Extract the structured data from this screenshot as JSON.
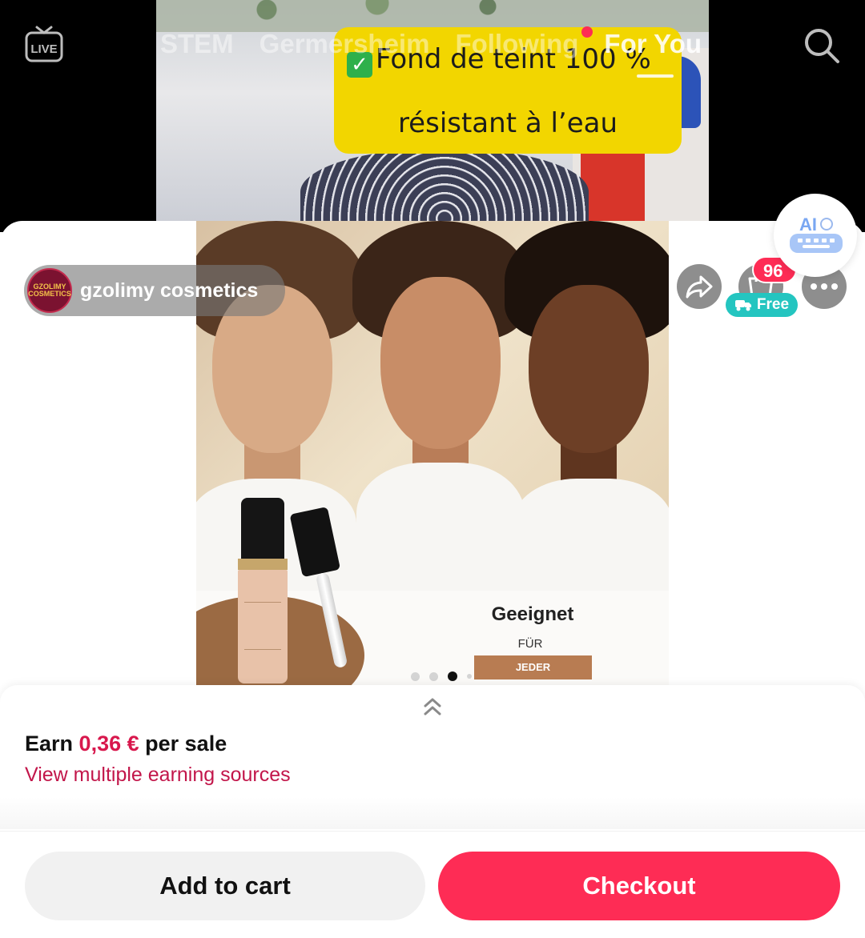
{
  "feed": {
    "tabs": [
      "STEM",
      "Germersheim",
      "Following",
      "For You"
    ],
    "active_tab": "For You",
    "live_label": "LIVE",
    "caption": {
      "line1": "Fond de teint 100 %",
      "line2": "résistant à l’eau"
    }
  },
  "product": {
    "shop_name": "gzolimy cosmetics",
    "shop_avatar_text": "GZOLIMY COSMETICS",
    "cart_count": "96",
    "free_label": "Free",
    "ai_label": "AI",
    "image_text": {
      "headline": "Geeignet",
      "sub": "FÜR",
      "tag": "JEDER"
    },
    "carousel": {
      "count": 4,
      "active_index": 2
    }
  },
  "earn": {
    "prefix": "Earn",
    "amount": "0,36 €",
    "suffix": "per sale",
    "link": "View multiple earning sources"
  },
  "actions": {
    "add_to_cart": "Add to cart",
    "checkout": "Checkout"
  },
  "colors": {
    "brand_red": "#fe2c55",
    "earn_red": "#d8184d",
    "free_teal": "#24c5c0",
    "caption_yellow": "#f2d600"
  },
  "icons": [
    "live-icon",
    "search-icon",
    "share-icon",
    "cart-icon",
    "truck-icon",
    "more-icon",
    "chevron-up-icon",
    "ai-keyboard-icon"
  ]
}
